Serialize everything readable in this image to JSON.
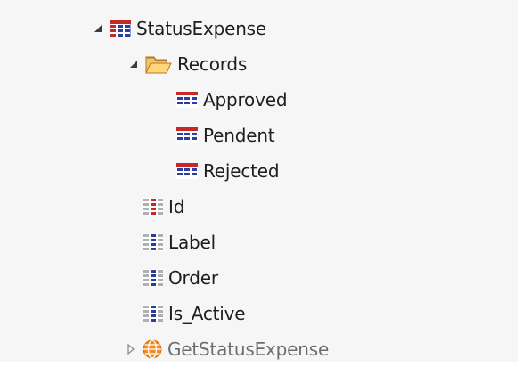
{
  "tree": {
    "entity": {
      "label": "StatusExpense",
      "icon": "entity-table-icon",
      "expanded": true
    },
    "records_folder": {
      "label": "Records",
      "icon": "folder-open-icon",
      "expanded": true,
      "items": [
        {
          "label": "Approved",
          "icon": "record-icon"
        },
        {
          "label": "Pendent",
          "icon": "record-icon"
        },
        {
          "label": "Rejected",
          "icon": "record-icon"
        }
      ]
    },
    "attributes": [
      {
        "label": "Id",
        "icon": "identifier-attribute-icon"
      },
      {
        "label": "Label",
        "icon": "attribute-icon"
      },
      {
        "label": "Order",
        "icon": "attribute-icon"
      },
      {
        "label": "Is_Active",
        "icon": "attribute-icon"
      }
    ],
    "action": {
      "label": "GetStatusExpense",
      "icon": "action-globe-icon",
      "expanded": false
    }
  }
}
